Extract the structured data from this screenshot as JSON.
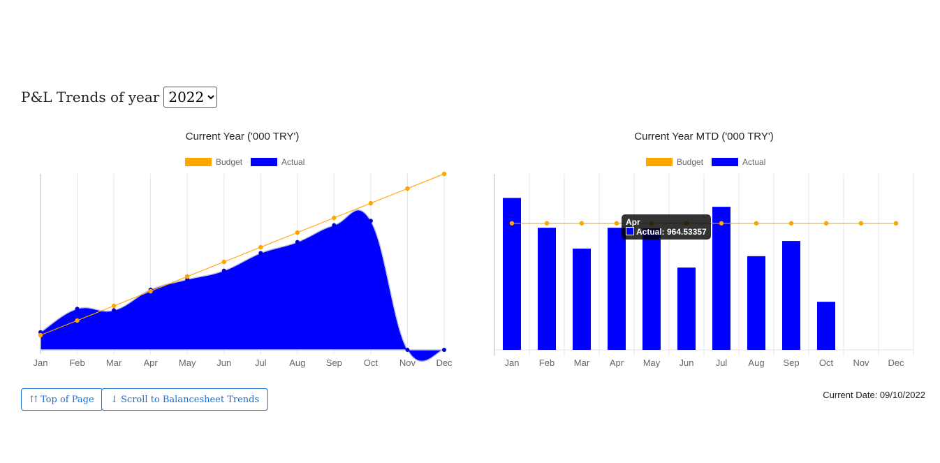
{
  "header": {
    "title": "P&L Trends of year",
    "year_selected": "2022",
    "year_options": [
      "2022"
    ]
  },
  "buttons": {
    "top_of_page": "⇈ Top of Page",
    "scroll_balancesheet": "↓ Scroll to Balancesheet Trends"
  },
  "current_date": "Current Date: 09/10/2022",
  "colors": {
    "budget": "#FFA500",
    "actual": "#0000FF",
    "grid": "#e5e5e5",
    "tick": "#666666"
  },
  "chart_data": [
    {
      "type": "area",
      "title": "Current Year ('000 TRY')",
      "categories": [
        "Jan",
        "Feb",
        "Mar",
        "Apr",
        "May",
        "Jun",
        "Jul",
        "Aug",
        "Sep",
        "Oct",
        "Nov",
        "Dec"
      ],
      "series": [
        {
          "name": "Budget",
          "kind": "line",
          "values": [
            1000,
            2000,
            3000,
            4000,
            5000,
            6000,
            7000,
            8000,
            9000,
            10000,
            11000,
            12000
          ]
        },
        {
          "name": "Actual",
          "kind": "area",
          "values": [
            1200,
            2800,
            2700,
            4100,
            4800,
            5400,
            6600,
            7350,
            8500,
            8800,
            0,
            0
          ]
        }
      ],
      "ylim": [
        0,
        12000
      ],
      "grid": true,
      "legend": "top"
    },
    {
      "type": "bar",
      "title": "Current Year MTD ('000 TRY')",
      "categories": [
        "Jan",
        "Feb",
        "Mar",
        "Apr",
        "May",
        "Jun",
        "Jul",
        "Aug",
        "Sep",
        "Oct",
        "Nov",
        "Dec"
      ],
      "series": [
        {
          "name": "Budget",
          "kind": "line",
          "values": [
            1000,
            1000,
            1000,
            1000,
            1000,
            1000,
            1000,
            1000,
            1000,
            1000,
            1000,
            1000
          ]
        },
        {
          "name": "Actual",
          "kind": "bar",
          "values": [
            1200,
            964.53,
            800,
            964.53,
            960,
            650,
            1130,
            740,
            860,
            380,
            0,
            0
          ]
        }
      ],
      "ylim": [
        0,
        1390
      ],
      "grid": true,
      "legend": "top",
      "tooltip": {
        "category": "Apr",
        "series": "Actual",
        "text": "Actual: 964.53357"
      }
    }
  ]
}
